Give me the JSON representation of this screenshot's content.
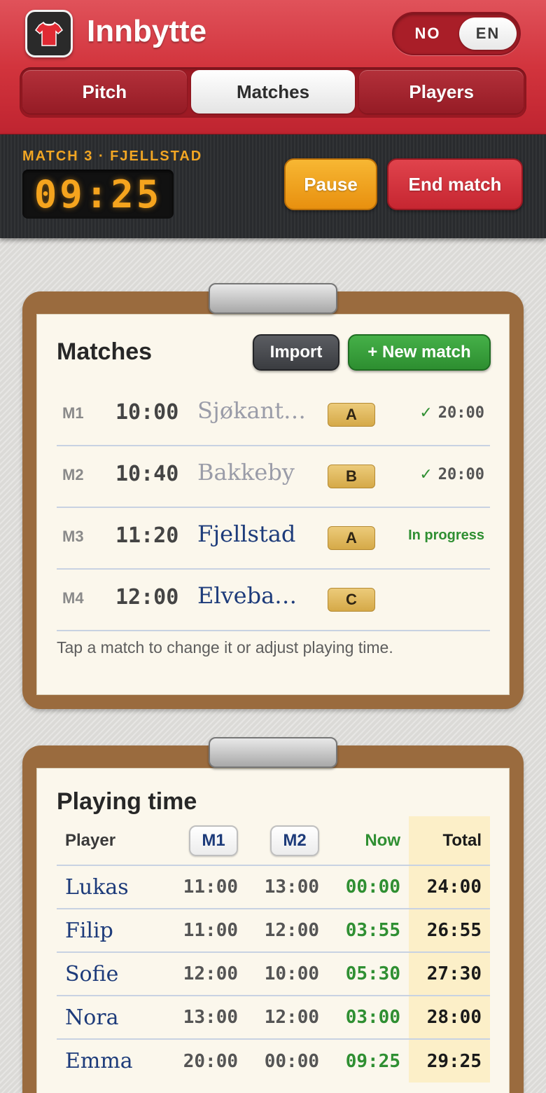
{
  "app": {
    "title": "Innbytte",
    "icon": "jersey-icon"
  },
  "language": {
    "options": [
      "NO",
      "EN"
    ],
    "selected": "EN"
  },
  "tabs": [
    {
      "label": "Pitch",
      "active": false
    },
    {
      "label": "Matches",
      "active": true
    },
    {
      "label": "Players",
      "active": false
    }
  ],
  "current_match": {
    "label": "MATCH 3 · FJELLSTAD",
    "clock": "09:25",
    "pause_label": "Pause",
    "end_label": "End match"
  },
  "matches_card": {
    "title": "Matches",
    "import_label": "Import",
    "new_label": "+ New match",
    "rows": [
      {
        "code": "M1",
        "time": "10:00",
        "opponent": "Sjøkanten",
        "field": "A",
        "status": "20:00",
        "state": "done"
      },
      {
        "code": "M2",
        "time": "10:40",
        "opponent": "Bakkeby",
        "field": "B",
        "status": "20:00",
        "state": "done"
      },
      {
        "code": "M3",
        "time": "11:20",
        "opponent": "Fjellstad",
        "field": "A",
        "status": "In progress",
        "state": "live"
      },
      {
        "code": "M4",
        "time": "12:00",
        "opponent": "Elvebakken",
        "field": "C",
        "status": "",
        "state": "upcoming"
      }
    ],
    "hint": "Tap a match to change it or adjust playing time."
  },
  "playing_time": {
    "title": "Playing time",
    "headers": {
      "player": "Player",
      "m1": "M1",
      "m2": "M2",
      "now": "Now",
      "total": "Total"
    },
    "rows": [
      {
        "player": "Lukas",
        "m1": "11:00",
        "m2": "13:00",
        "now": "00:00",
        "total": "24:00"
      },
      {
        "player": "Filip",
        "m1": "11:00",
        "m2": "12:00",
        "now": "03:55",
        "total": "26:55"
      },
      {
        "player": "Sofie",
        "m1": "12:00",
        "m2": "10:00",
        "now": "05:30",
        "total": "27:30"
      },
      {
        "player": "Nora",
        "m1": "13:00",
        "m2": "12:00",
        "now": "03:00",
        "total": "28:00"
      },
      {
        "player": "Emma",
        "m1": "20:00",
        "m2": "00:00",
        "now": "09:25",
        "total": "29:25"
      }
    ]
  },
  "colors": {
    "brand_red": "#d2343d",
    "accent_orange": "#f5a41e",
    "success_green": "#2f8f32",
    "ink_blue": "#1d3b7a"
  }
}
